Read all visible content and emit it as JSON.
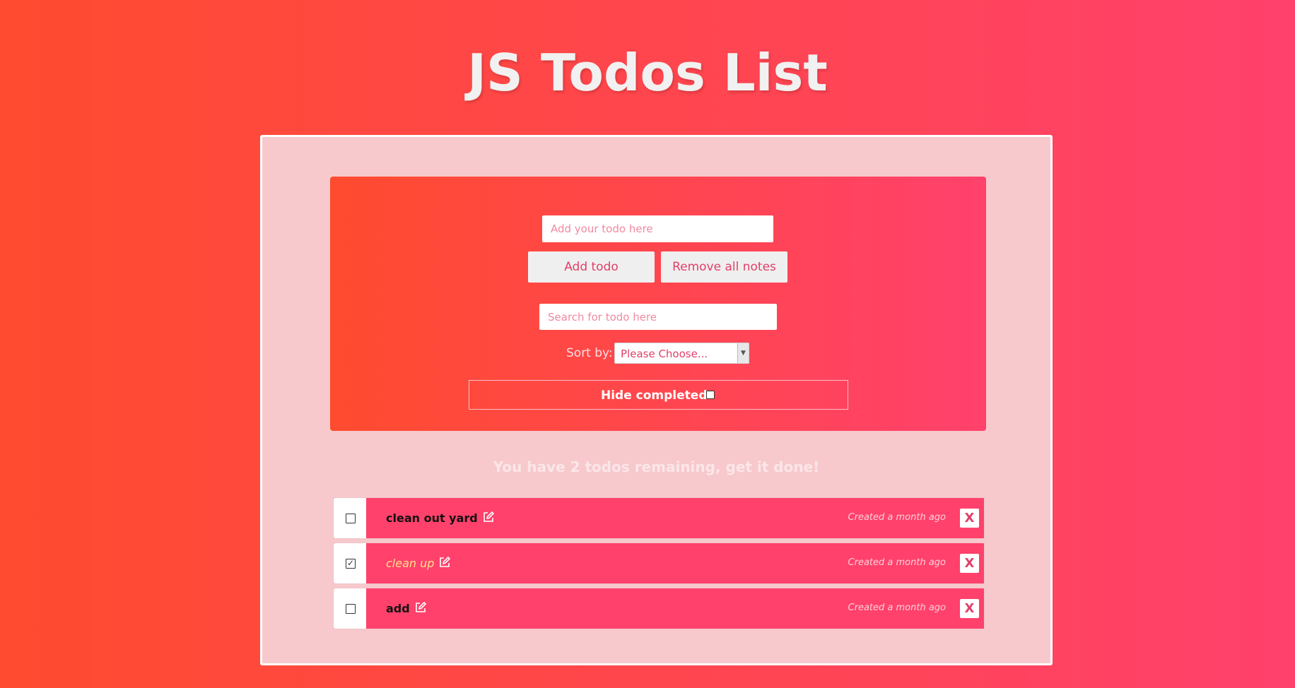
{
  "header": {
    "title": "JS Todos List"
  },
  "form": {
    "todo_placeholder": "Add your todo here",
    "add_label": "Add todo",
    "remove_all_label": "Remove all notes",
    "search_placeholder": "Search for todo here",
    "sort_label": "Sort by:",
    "sort_selected": "Please Choose...",
    "hide_completed_label": "Hide completed:",
    "hide_completed_checked": false
  },
  "summary": "You have 2 todos remaining, get it done!",
  "todos": [
    {
      "text": "clean out yard",
      "completed": false,
      "created": "Created a month ago",
      "delete_label": "X"
    },
    {
      "text": "clean up",
      "completed": true,
      "created": "Created a month ago",
      "delete_label": "X"
    },
    {
      "text": "add",
      "completed": false,
      "created": "Created a month ago",
      "delete_label": "X"
    }
  ],
  "icons": {
    "edit": "edit-icon",
    "check": "checkbox-icon",
    "delete": "close-icon"
  },
  "colors": {
    "gradient_start": "#ff4b2f",
    "gradient_end": "#ff416c",
    "container_bg": "#f7c9cc",
    "accent": "#e0406a",
    "completed_text": "#ffe28a"
  }
}
